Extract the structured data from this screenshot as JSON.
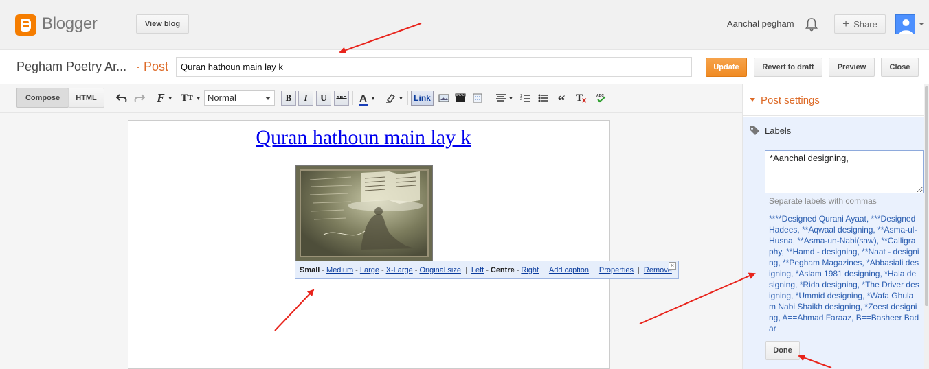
{
  "header": {
    "logo_text": "Blogger",
    "view_blog_label": "View blog",
    "user_name": "Aanchal pegham",
    "share_label": "Share"
  },
  "title_row": {
    "blog_name": "Pegham Poetry Ar...",
    "post_crumb": "· Post",
    "post_title_value": "Quran hathoun main lay k",
    "update_label": "Update",
    "revert_label": "Revert to draft",
    "preview_label": "Preview",
    "close_label": "Close"
  },
  "toolbar": {
    "compose_label": "Compose",
    "html_label": "HTML",
    "font_size_value": "Normal",
    "bold_label": "B",
    "italic_label": "I",
    "underline_label": "U",
    "strike_label": "ABC",
    "link_label": "Link",
    "icons": [
      "undo-icon",
      "redo-icon",
      "font-family-icon",
      "font-size-icon",
      "text-color-icon",
      "highlight-icon",
      "image-icon",
      "video-icon",
      "jump-break-icon",
      "align-icon",
      "numbered-list-icon",
      "bulleted-list-icon",
      "quote-icon",
      "clear-format-icon",
      "spellcheck-icon"
    ]
  },
  "editor": {
    "post_heading": "Quran hathoun main lay k",
    "image_toolbar": {
      "sizes": [
        "Small",
        "Medium",
        "Large",
        "X-Large",
        "Original size"
      ],
      "selected_size": "Small",
      "alignments": [
        "Left",
        "Centre",
        "Right"
      ],
      "selected_alignment": "Centre",
      "add_caption": "Add caption",
      "properties": "Properties",
      "remove": "Remove"
    }
  },
  "post_settings": {
    "title": "Post settings",
    "labels_title": "Labels",
    "labels_input_value": "*Aanchal designing,",
    "labels_hint": "Separate labels with commas",
    "existing_labels": "****Designed Qurani Ayaat, ***Designed Hadees, **Aqwaal designing, **Asma-ul-Husna, **Asma-un-Nabi(saw), **Calligraphy, **Hamd - designing, **Naat - designing, **Pegham Magazines, *Abbasiali designing, *Aslam 1981 designing, *Hala designing, *Rida designing, *The Driver designing, *Ummid designing, *Wafa Ghulam Nabi Shaikh designing, *Zeest designing, A==Ahmad Faraaz, B==Basheer Badar",
    "done_label": "Done"
  },
  "colors": {
    "brand_orange": "#f57d00",
    "accent_orange": "#dd6a27",
    "link_blue": "#2a5db0",
    "annotation_red": "#e8241c"
  }
}
